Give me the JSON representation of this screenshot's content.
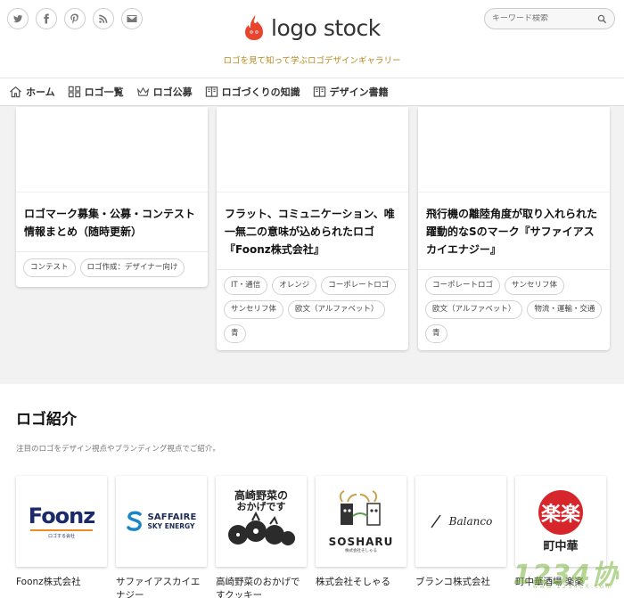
{
  "header": {
    "social_icons": [
      "twitter-icon",
      "facebook-icon",
      "pinterest-icon",
      "rss-icon",
      "mail-icon"
    ],
    "logo_text": "logo stock",
    "tagline": "ロゴを見て知って学ぶロゴデザインギャラリー",
    "search_placeholder": "キーワード検索"
  },
  "nav": {
    "items": [
      {
        "label": "ホーム",
        "icon": "home-icon"
      },
      {
        "label": "ロゴ一覧",
        "icon": "grid-icon"
      },
      {
        "label": "ロゴ公募",
        "icon": "crown-icon"
      },
      {
        "label": "ロゴづくりの知識",
        "icon": "book-icon"
      },
      {
        "label": "デザイン書籍",
        "icon": "book-icon"
      }
    ]
  },
  "articles": [
    {
      "title": "ロゴマーク募集・公募・コンテスト情報まとめ（随時更新）",
      "tags": [
        "コンテスト",
        "ロゴ作成：デザイナー向け"
      ]
    },
    {
      "title": "フラット、コミュニケーション、唯一無二の意味が込められたロゴ『Foonz株式会社』",
      "tags": [
        "IT・通信",
        "オレンジ",
        "コーポレートロゴ",
        "サンセリフ体",
        "欧文（アルファベット）",
        "青"
      ]
    },
    {
      "title": "飛行機の離陸角度が取り入れられた躍動的なSのマーク『サファイアスカイエナジー』",
      "tags": [
        "コーポレートロゴ",
        "サンセリフ体",
        "欧文（アルファベット）",
        "物流・運輸・交通",
        "青"
      ]
    }
  ],
  "logo_section": {
    "title": "ロゴ紹介",
    "description": "注目のロゴをデザイン視点やブランディング視点でご紹介。",
    "logos": [
      {
        "name": "Foonz株式会社",
        "mark": "Foonz",
        "sub": "ロゴする会社"
      },
      {
        "name": "サファイアスカイエナジー",
        "mark": "SAFFAIRE",
        "sub": "SKY ENERGY"
      },
      {
        "name": "高崎野菜のおかげですクッキー",
        "mark": "高崎野菜の",
        "sub": "おかげです"
      },
      {
        "name": "株式会社そしゃる",
        "mark": "SOSHARU",
        "sub": "株式会社そしゃる"
      },
      {
        "name": "ブランコ株式会社",
        "mark": "Balanco",
        "sub": ""
      },
      {
        "name": "町中華酒場 楽楽",
        "mark": "楽楽",
        "sub": "町中華"
      }
    ]
  },
  "watermark": {
    "text": "1234协",
    "sub": "www.1234LX.com"
  },
  "colors": {
    "accent_gold": "#b58a1e",
    "foonz_blue": "#1b2a6b",
    "foonz_orange": "#f08a24",
    "saffaire_blue": "#1a86c7",
    "rakuraku_red": "#d6262c"
  }
}
